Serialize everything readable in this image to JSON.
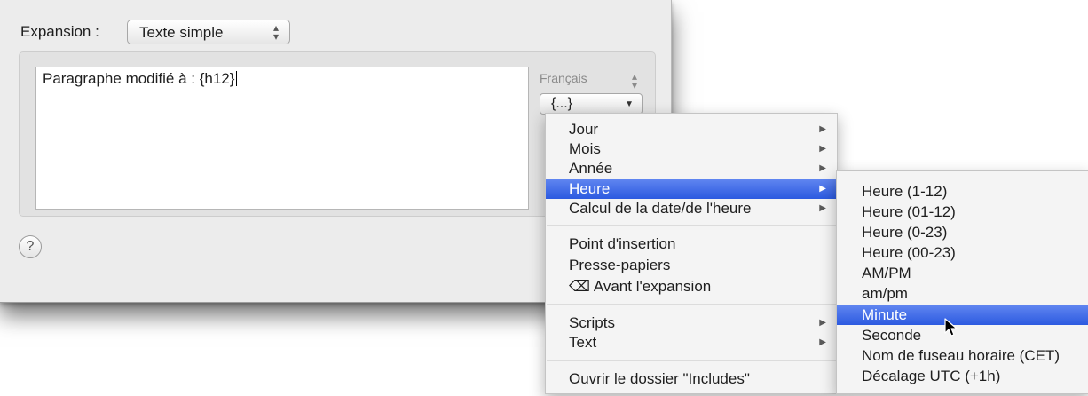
{
  "expansion": {
    "label": "Expansion :",
    "value": "Texte simple"
  },
  "editor": {
    "text": "Paragraphe modifié à : {h12}"
  },
  "language": {
    "value": "Français"
  },
  "insert_popup": {
    "label": "{...}"
  },
  "help": {
    "label": "?"
  },
  "main_menu": {
    "items": [
      {
        "label": "Jour",
        "submenu": true
      },
      {
        "label": "Mois",
        "submenu": true
      },
      {
        "label": "Année",
        "submenu": true
      },
      {
        "label": "Heure",
        "submenu": true,
        "highlighted": true
      },
      {
        "label": "Calcul de la date/de l'heure",
        "submenu": true
      },
      {
        "label": "Point d'insertion"
      },
      {
        "label": "Presse-papiers"
      },
      {
        "label": "⌫ Avant l'expansion"
      },
      {
        "label": "Scripts",
        "submenu": true
      },
      {
        "label": "Text",
        "submenu": true
      },
      {
        "label": "Ouvrir le dossier \"Includes\""
      }
    ]
  },
  "heure_submenu": {
    "items": [
      {
        "label": "Heure (1-12)"
      },
      {
        "label": "Heure (01-12)"
      },
      {
        "label": "Heure (0-23)"
      },
      {
        "label": "Heure (00-23)"
      },
      {
        "label": "AM/PM"
      },
      {
        "label": "am/pm"
      },
      {
        "label": "Minute",
        "highlighted": true
      },
      {
        "label": "Seconde"
      },
      {
        "label": "Nom de fuseau horaire (CET)"
      },
      {
        "label": "Décalage UTC (+1h)"
      }
    ]
  },
  "colors": {
    "highlight": "#3a66e6",
    "window": "#ececec",
    "menu": "#f4f4f4"
  }
}
